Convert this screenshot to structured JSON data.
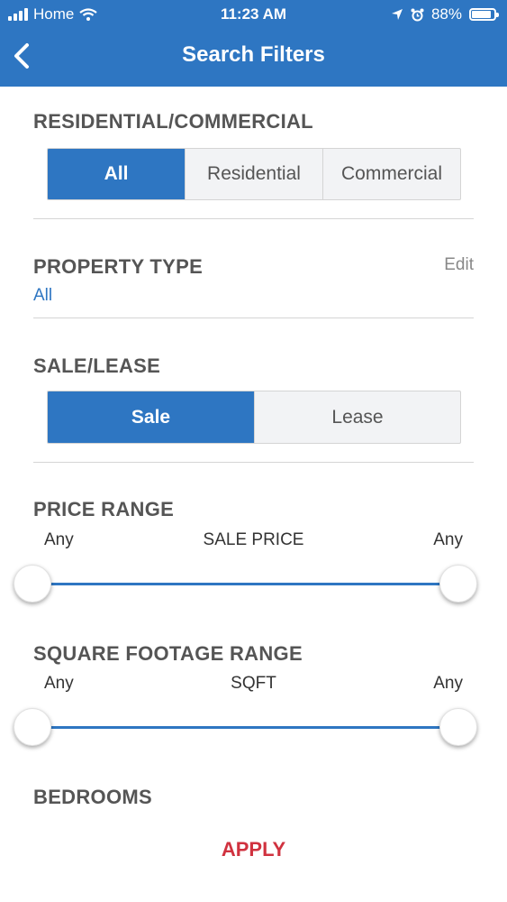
{
  "status_bar": {
    "carrier": "Home",
    "time": "11:23 AM",
    "battery": "88%",
    "battery_level": 0.88
  },
  "header": {
    "title": "Search Filters",
    "back_icon": "chevron-left-icon"
  },
  "residential_commercial": {
    "title": "RESIDENTIAL/COMMERCIAL",
    "options": [
      "All",
      "Residential",
      "Commercial"
    ],
    "selected": "All"
  },
  "property_type": {
    "title": "PROPERTY TYPE",
    "edit_label": "Edit",
    "value": "All"
  },
  "sale_lease": {
    "title": "SALE/LEASE",
    "options": [
      "Sale",
      "Lease"
    ],
    "selected": "Sale"
  },
  "price_range": {
    "title": "PRICE RANGE",
    "min_label": "Any",
    "center_label": "SALE PRICE",
    "max_label": "Any"
  },
  "sqft_range": {
    "title": "SQUARE FOOTAGE RANGE",
    "min_label": "Any",
    "center_label": "SQFT",
    "max_label": "Any"
  },
  "bedrooms": {
    "title": "BEDROOMS"
  },
  "apply_label": "APPLY",
  "colors": {
    "accent": "#2e76c2",
    "apply": "#d0323f"
  }
}
